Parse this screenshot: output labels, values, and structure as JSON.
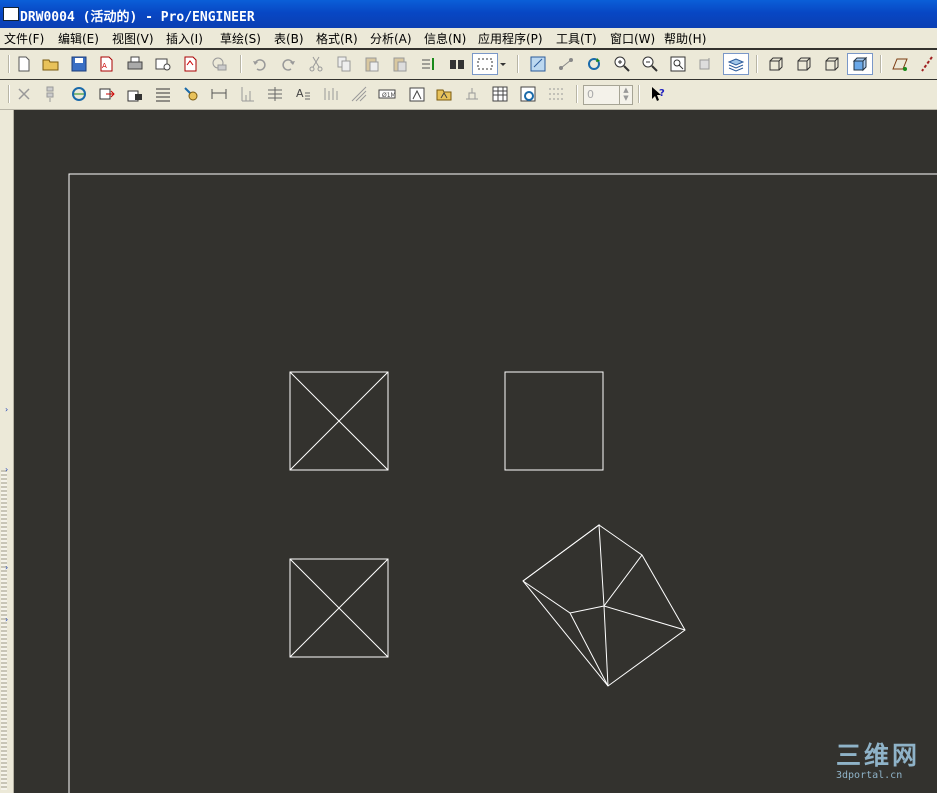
{
  "window": {
    "title": "DRW0004 (活动的) - Pro/ENGINEER"
  },
  "menu": {
    "items": [
      "文件(F)",
      "编辑(E)",
      "视图(V)",
      "插入(I)",
      "草绘(S)",
      "表(B)",
      "格式(R)",
      "分析(A)",
      "信息(N)",
      "应用程序(P)",
      "工具(T)",
      "窗口(W)",
      "帮助(H)"
    ]
  },
  "toolbar": {
    "row1": [
      "new-icon",
      "open-icon",
      "save-icon",
      "save-copy-icon",
      "print-icon",
      "email-icon",
      "send-pdf-icon",
      "link-icon",
      "undo-icon",
      "redo-icon",
      "cut-icon",
      "copy-icon",
      "paste-icon",
      "paste-special-icon",
      "regenerate-icon",
      "find-icon",
      "select-box-icon",
      "sketch-edit-icon",
      "sketch-icon",
      "repaint-icon",
      "zoom-in-icon",
      "zoom-out-icon",
      "refit-icon",
      "orient-icon",
      "layers-icon",
      "wireframe-icon",
      "hidden-line-icon",
      "no-hidden-icon",
      "shading-icon",
      "datum-plane-icon",
      "datum-axis-icon"
    ],
    "row2": [
      "delete-icon",
      "move-icon",
      "swap-icon",
      "align-icon",
      "lock-icon",
      "table-icon",
      "show-annotation-icon",
      "dimension-icon",
      "ordinate-icon",
      "aligned-dim-icon",
      "note-icon",
      "tolerance-icon",
      "surface-finish-icon",
      "geom-tol-icon",
      "datum-icon",
      "balloon-icon",
      "symbol-icon",
      "insert-table-icon",
      "repeat-region-icon",
      "grid-icon",
      "layer-value-icon",
      "help-cursor-icon"
    ],
    "spinner_value": "0"
  },
  "canvas": {
    "background": "#33322e",
    "line_color": "#ffffff"
  },
  "watermark": {
    "logo": "三维网",
    "url": "3dportal.cn"
  }
}
